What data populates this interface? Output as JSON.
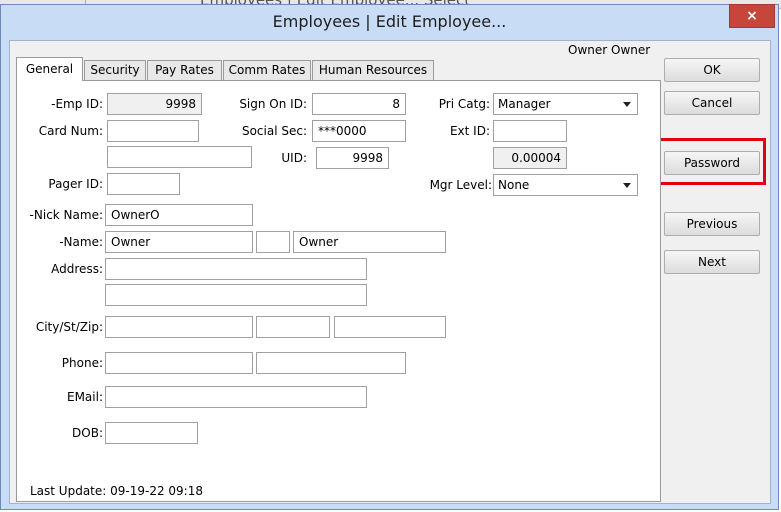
{
  "window": {
    "title": "Employees | Edit Employee...",
    "close": "×"
  },
  "background": {
    "title_fragment": "Employees | Edit Employee... Select"
  },
  "header": {
    "owner": "Owner Owner"
  },
  "tabs": [
    {
      "label": "General"
    },
    {
      "label": "Security"
    },
    {
      "label": "Pay Rates"
    },
    {
      "label": "Comm Rates"
    },
    {
      "label": "Human Resources"
    }
  ],
  "fields": {
    "emp_id": {
      "label": "-Emp ID:",
      "value": "9998"
    },
    "sign_on_id": {
      "label": "Sign On ID:",
      "value": "8"
    },
    "pri_catg": {
      "label": "Pri Catg:",
      "value": "Manager"
    },
    "card_num": {
      "label": "Card Num:",
      "value": ""
    },
    "social_sec": {
      "label": "Social Sec:",
      "value": "***0000"
    },
    "ext_id": {
      "label": "Ext ID:",
      "value": ""
    },
    "extra_card": {
      "value": ""
    },
    "uid": {
      "label": "UID:",
      "value": "9998"
    },
    "ratio": {
      "value": "0.00004"
    },
    "pager_id": {
      "label": "Pager ID:",
      "value": ""
    },
    "mgr_level": {
      "label": "Mgr Level:",
      "value": "None"
    },
    "nick_name": {
      "label": "-Nick Name:",
      "value": "OwnerO"
    },
    "name": {
      "label": "-Name:",
      "first": "Owner",
      "middle": "",
      "last": "Owner"
    },
    "address": {
      "label": "Address:",
      "line1": "",
      "line2": ""
    },
    "city_st_zip": {
      "label": "City/St/Zip:",
      "city": "",
      "state": "",
      "zip": ""
    },
    "phone": {
      "label": "Phone:",
      "phone1": "",
      "phone2": ""
    },
    "email": {
      "label": "EMail:",
      "value": ""
    },
    "dob": {
      "label": "DOB:",
      "value": ""
    }
  },
  "footer": {
    "last_update": "Last Update: 09-19-22 09:18"
  },
  "buttons": {
    "ok": "OK",
    "cancel": "Cancel",
    "password": "Password",
    "previous": "Previous",
    "next": "Next"
  },
  "colors": {
    "highlight": "#e0000f",
    "close": "#c7463b",
    "frame": "#c9dcf5"
  }
}
